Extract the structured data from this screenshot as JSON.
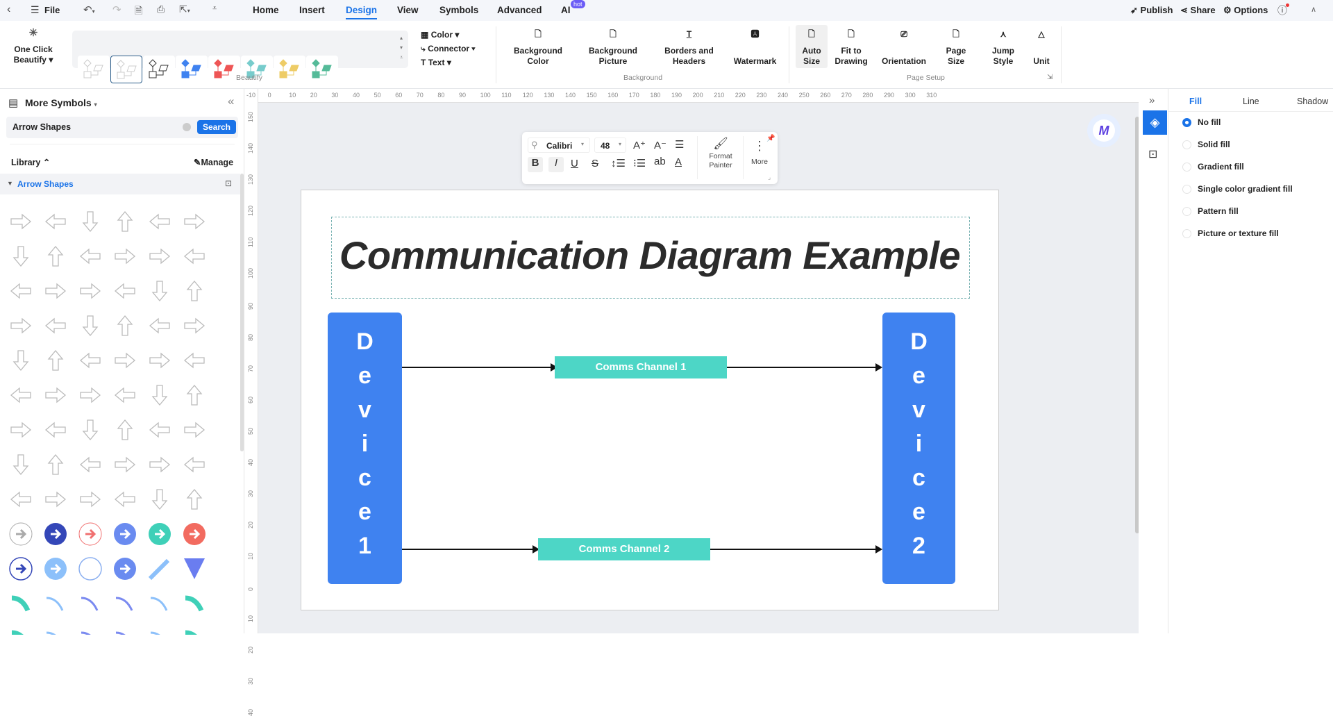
{
  "menubar": {
    "file": "File",
    "tabs": [
      "Home",
      "Insert",
      "Design",
      "View",
      "Symbols",
      "Advanced",
      "AI"
    ],
    "active_tab": "Design",
    "ai_badge": "hot",
    "publish": "Publish",
    "share": "Share",
    "options": "Options"
  },
  "ribbon": {
    "one_click": [
      "One Click",
      "Beautify"
    ],
    "beautify_group": "Beautify",
    "style_menu": [
      "Color",
      "Connector",
      "Text"
    ],
    "background": [
      [
        "Background",
        "Color"
      ],
      [
        "Background",
        "Picture"
      ],
      [
        "Borders and",
        "Headers"
      ],
      [
        "Watermark",
        ""
      ]
    ],
    "background_group": "Background",
    "page_setup": [
      [
        "Auto",
        "Size"
      ],
      [
        "Fit to",
        "Drawing"
      ],
      [
        "Orientation",
        ""
      ],
      [
        "Page",
        "Size"
      ],
      [
        "Jump",
        "Style"
      ],
      [
        "Unit",
        ""
      ]
    ],
    "page_setup_group": "Page Setup"
  },
  "rulers": {
    "h": [
      "-10",
      "0",
      "10",
      "20",
      "30",
      "40",
      "50",
      "60",
      "70",
      "80",
      "90",
      "100",
      "110",
      "120",
      "130",
      "140",
      "150",
      "160",
      "170",
      "180",
      "190",
      "200",
      "210",
      "220",
      "230",
      "240",
      "250",
      "260",
      "270",
      "280",
      "290",
      "300",
      "310"
    ],
    "v": [
      "150",
      "140",
      "130",
      "120",
      "110",
      "100",
      "90",
      "80",
      "70",
      "60",
      "50",
      "40",
      "30",
      "20",
      "10",
      "0",
      "10",
      "20",
      "30",
      "40"
    ]
  },
  "left_panel": {
    "title": "More Symbols",
    "search_value": "Arrow Shapes",
    "search_button": "Search",
    "library": "Library",
    "manage": "Manage",
    "category": "Arrow Shapes"
  },
  "text_toolbar": {
    "font": "Calibri",
    "size": "48",
    "format_painter": [
      "Format",
      "Painter"
    ],
    "more": "More",
    "ab": "ab"
  },
  "diagram": {
    "title": "Communication Diagram Example",
    "device1": [
      "D",
      "e",
      "v",
      "i",
      "c",
      "e",
      "1"
    ],
    "device2": [
      "D",
      "e",
      "v",
      "i",
      "c",
      "e",
      "2"
    ],
    "channel1": "Comms Channel 1",
    "channel2": "Comms Channel 2",
    "colors": {
      "device": "#3f82f0",
      "channel": "#4dd6c6"
    }
  },
  "right_panel": {
    "tabs": [
      "Fill",
      "Line",
      "Shadow"
    ],
    "active_tab": "Fill",
    "options": [
      "No fill",
      "Solid fill",
      "Gradient fill",
      "Single color gradient fill",
      "Pattern fill",
      "Picture or texture fill"
    ],
    "selected": "No fill"
  },
  "colors": {
    "accent": "#1a73e8"
  }
}
